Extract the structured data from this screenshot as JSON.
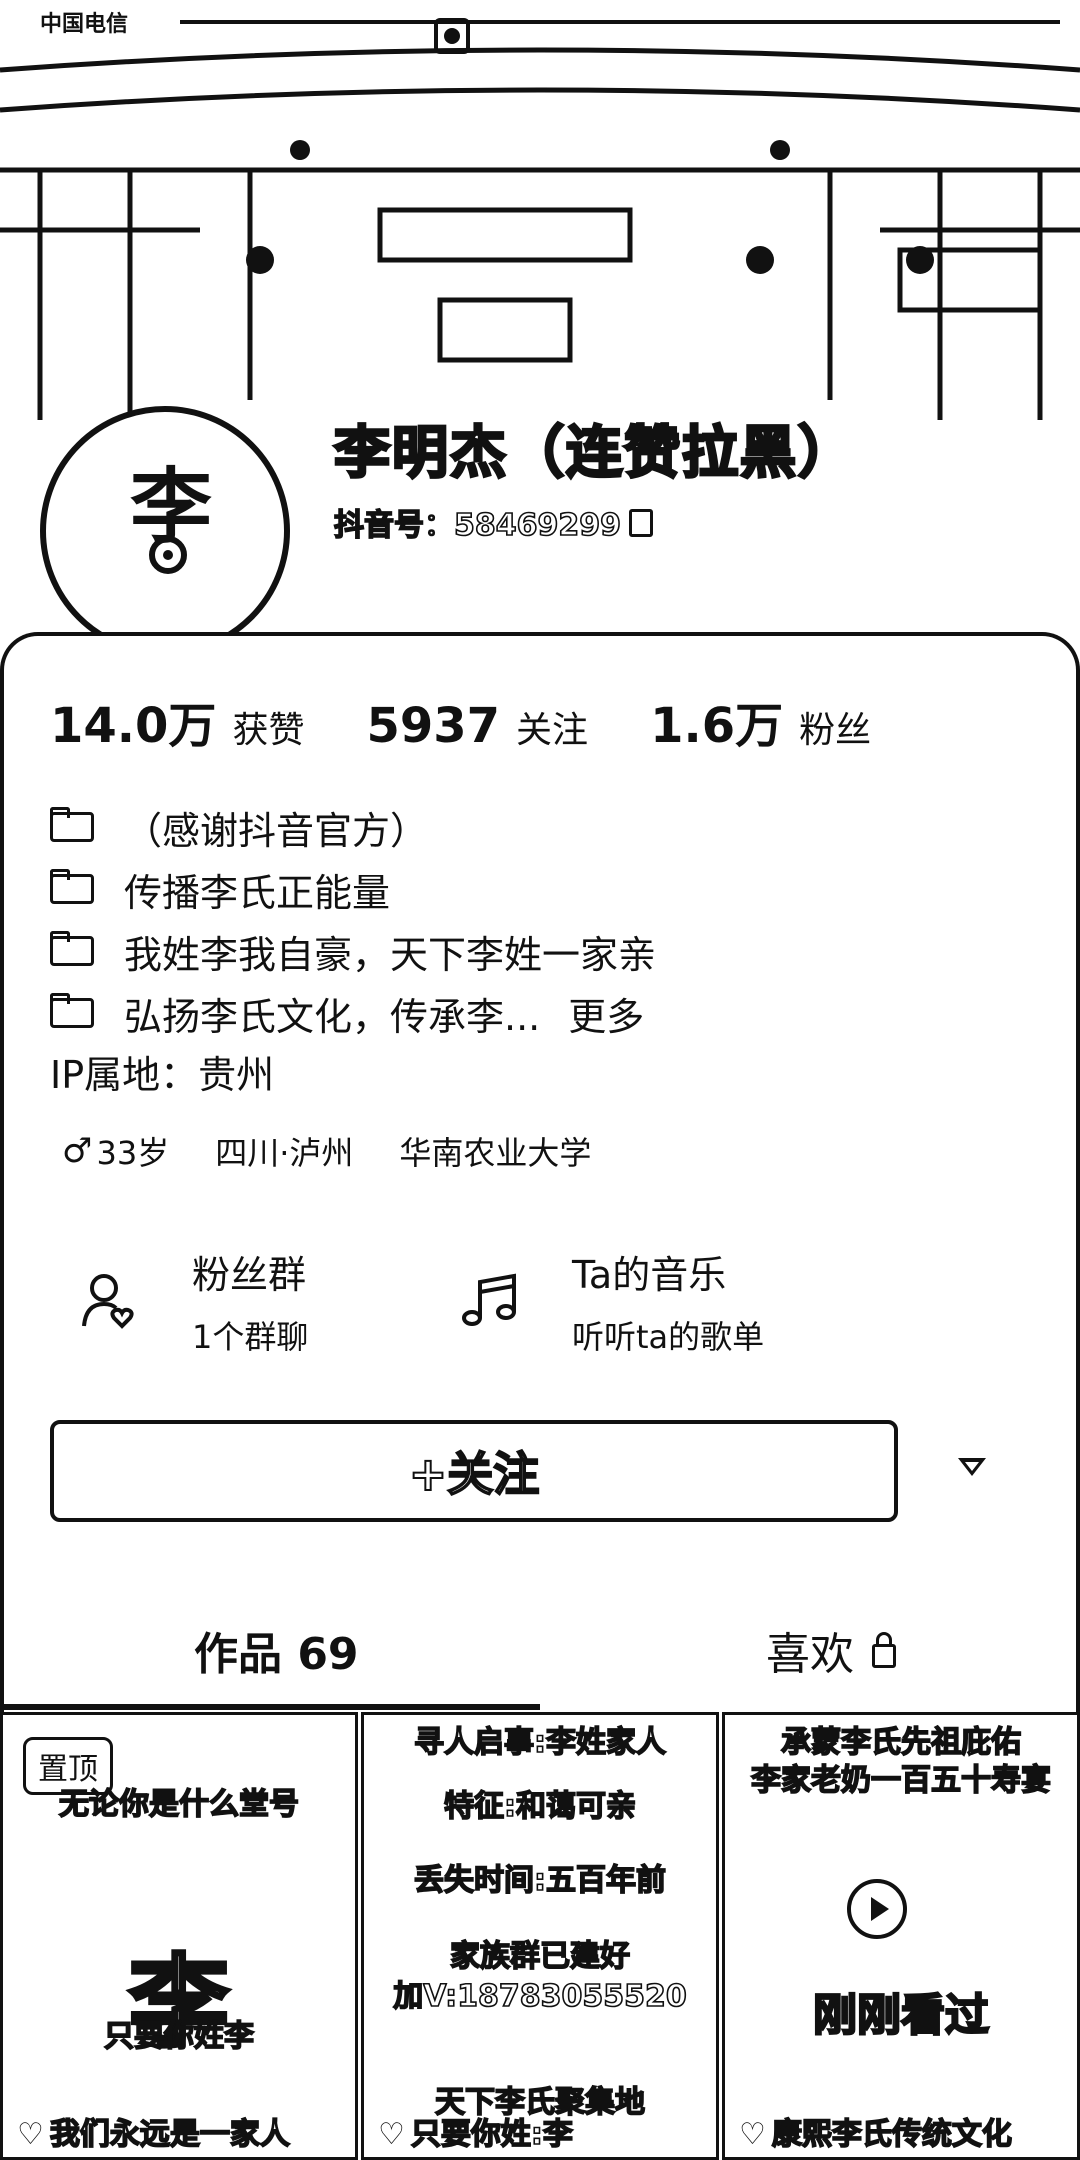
{
  "status_bar": {
    "carrier": "中国电信"
  },
  "profile": {
    "avatar_char": "李",
    "name": "李明杰（连赞拉黑）",
    "douyin_id": "抖音号：58469299"
  },
  "stats": [
    {
      "value": "14.0万",
      "label": "获赞"
    },
    {
      "value": "5937",
      "label": "关注"
    },
    {
      "value": "1.6万",
      "label": "粉丝"
    }
  ],
  "bio": {
    "lines": [
      "（感谢抖音官方）",
      "传播李氏正能量",
      "我姓李我自豪，天下李姓一家亲",
      "弘扬李氏文化，传承李..."
    ],
    "more": "更多"
  },
  "ip": "IP属地：贵州",
  "tags": {
    "gender_icon": "♂",
    "age": "33岁",
    "location": "四川·泸州",
    "school": "华南农业大学"
  },
  "features": [
    {
      "title": "粉丝群",
      "subtitle": "1个群聊",
      "icon": "fans-icon"
    },
    {
      "title": "Ta的音乐",
      "subtitle": "听听ta的歌单",
      "icon": "music-icon"
    }
  ],
  "follow_label": "+关注",
  "tabs": {
    "works": "作品 69",
    "likes": "喜欢"
  },
  "grid": [
    {
      "pinned": "置顶",
      "lines": [
        "无论你是什么堂号",
        "只要你姓李"
      ],
      "big_char": "李",
      "footer": "我们永远是一家人"
    },
    {
      "lines": [
        "寻人启事:李姓家人",
        "特征:和蔼可亲",
        "丢失时间:五百年前",
        "家族群已建好",
        "加V:18783055520",
        "天下李氏聚集地"
      ],
      "footer": "只要你姓:李"
    },
    {
      "lines": [
        "承蒙李氏先祖庇佑",
        "李家老奶一百五十寿宴"
      ],
      "seen": "刚刚看过",
      "footer": "康熙李氏传统文化"
    }
  ]
}
